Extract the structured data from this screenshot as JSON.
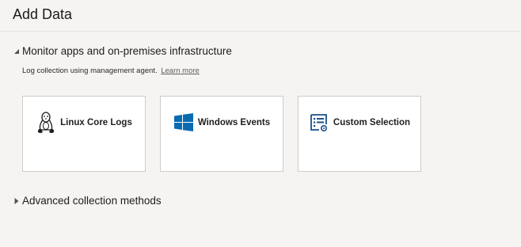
{
  "header": {
    "title": "Add Data"
  },
  "sections": [
    {
      "title": "Monitor apps and on-premises infrastructure",
      "expanded": true,
      "description": "Log collection using management agent.",
      "link": "Learn more",
      "cards": [
        {
          "label": "Linux Core Logs",
          "icon": "linux-penguin-icon"
        },
        {
          "label": "Windows Events",
          "icon": "windows-logo-icon"
        },
        {
          "label": "Custom Selection",
          "icon": "custom-selection-icon"
        }
      ]
    },
    {
      "title": "Advanced collection methods",
      "expanded": false
    }
  ],
  "colors": {
    "background": "#f5f4f2",
    "card_background": "#ffffff",
    "card_border": "#cfccc8",
    "windows_blue": "#0a6bb0",
    "custom_icon_blue": "#1b4f8c"
  }
}
